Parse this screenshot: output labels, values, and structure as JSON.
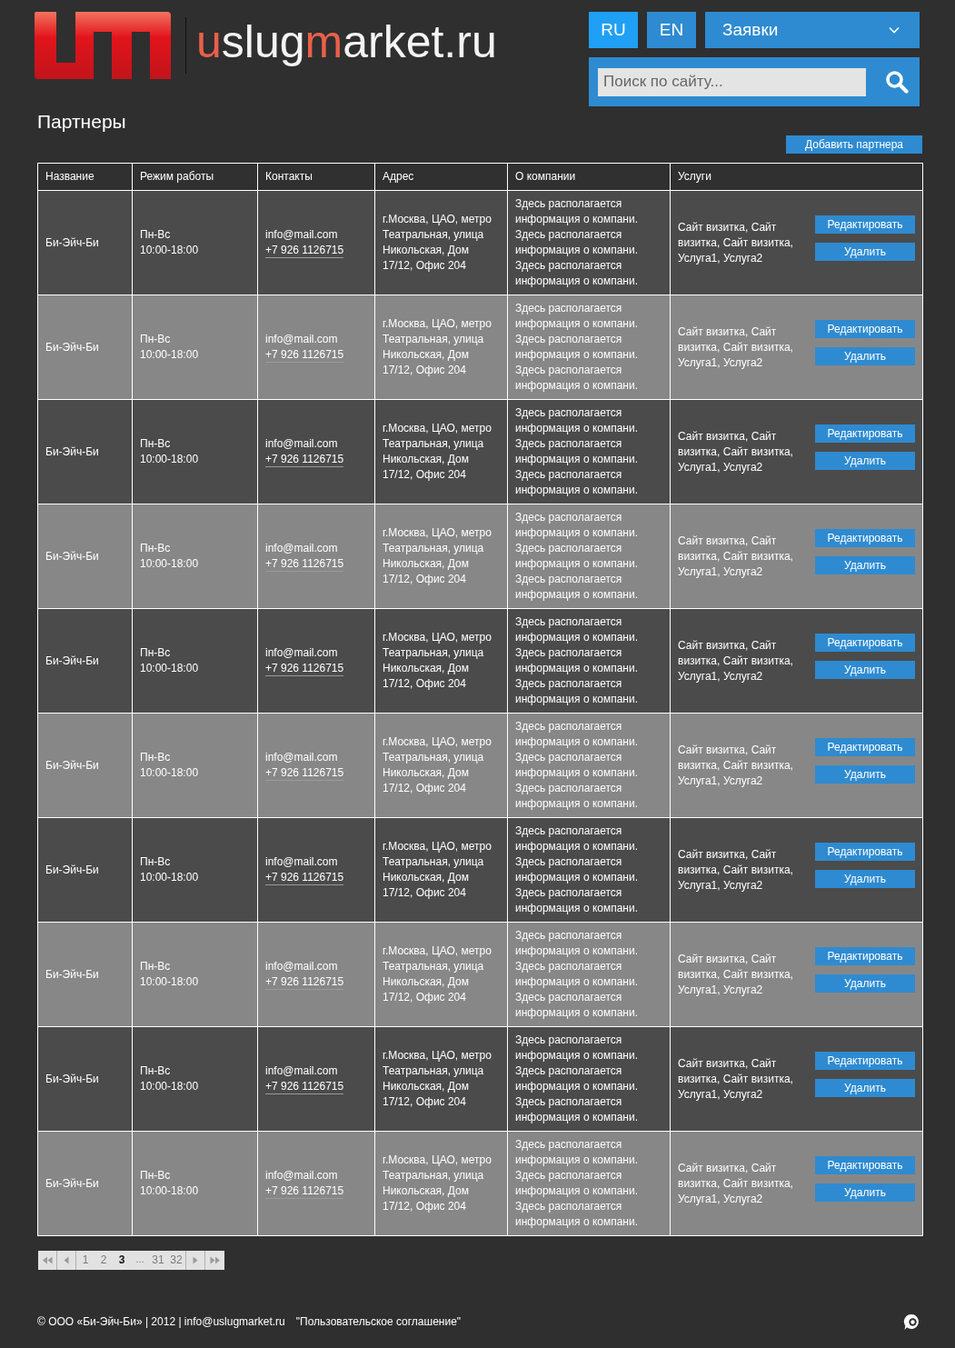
{
  "header": {
    "logo": {
      "parts": [
        {
          "text": "u",
          "accent": true
        },
        {
          "text": "slug",
          "accent": false
        },
        {
          "text": "m",
          "accent": true
        },
        {
          "text": "arket.ru",
          "accent": false
        }
      ]
    },
    "languages": [
      {
        "label": "RU",
        "selected": true
      },
      {
        "label": "EN",
        "selected": false
      }
    ],
    "menu": {
      "label": "Заявки"
    },
    "search": {
      "placeholder": "Поиск по сайту..."
    }
  },
  "page": {
    "title": "Партнеры",
    "add_button": "Добавить партнера"
  },
  "table": {
    "columns": [
      "Название",
      "Режим работы",
      "Контакты",
      "Адрес",
      "О компании",
      "Услуги"
    ],
    "rows": [
      {
        "name": "Би-Эйч-Би",
        "days": "Пн-Вс",
        "time": "10:00-18:00",
        "email": "info@mail.com",
        "phone": "+7 926 1126715",
        "address": "г.Москва, ЦАО, метро Театральная, улица Никольская, Дом 17/12, Офис 204",
        "about": "Здесь располагается информация о компани. Здесь располагается информация о компани. Здесь располагается информация о компани.",
        "services": "Сайт визитка, Сайт визитка, Сайт визитка, Услуга1, Услуга2",
        "actions": [
          "Редактировать",
          "Удалить"
        ]
      },
      {
        "name": "Би-Эйч-Би",
        "days": "Пн-Вс",
        "time": "10:00-18:00",
        "email": "info@mail.com",
        "phone": "+7 926 1126715",
        "address": "г.Москва, ЦАО, метро Театральная, улица Никольская, Дом 17/12, Офис 204",
        "about": "Здесь располагается информация о компани. Здесь располагается информация о компани. Здесь располагается информация о компани.",
        "services": "Сайт визитка, Сайт визитка, Сайт визитка, Услуга1, Услуга2",
        "actions": [
          "Редактировать",
          "Удалить"
        ]
      },
      {
        "name": "Би-Эйч-Би",
        "days": "Пн-Вс",
        "time": "10:00-18:00",
        "email": "info@mail.com",
        "phone": "+7 926 1126715",
        "address": "г.Москва, ЦАО, метро Театральная, улица Никольская, Дом 17/12, Офис 204",
        "about": "Здесь располагается информация о компани. Здесь располагается информация о компани. Здесь располагается информация о компани.",
        "services": "Сайт визитка, Сайт визитка, Сайт визитка, Услуга1, Услуга2",
        "actions": [
          "Редактировать",
          "Удалить"
        ]
      },
      {
        "name": "Би-Эйч-Би",
        "days": "Пн-Вс",
        "time": "10:00-18:00",
        "email": "info@mail.com",
        "phone": "+7 926 1126715",
        "address": "г.Москва, ЦАО, метро Театральная, улица Никольская, Дом 17/12, Офис 204",
        "about": "Здесь располагается информация о компани. Здесь располагается информация о компани. Здесь располагается информация о компани.",
        "services": "Сайт визитка, Сайт визитка, Сайт визитка, Услуга1, Услуга2",
        "actions": [
          "Редактировать",
          "Удалить"
        ]
      },
      {
        "name": "Би-Эйч-Би",
        "days": "Пн-Вс",
        "time": "10:00-18:00",
        "email": "info@mail.com",
        "phone": "+7 926 1126715",
        "address": "г.Москва, ЦАО, метро Театральная, улица Никольская, Дом 17/12, Офис 204",
        "about": "Здесь располагается информация о компани. Здесь располагается информация о компани. Здесь располагается информация о компани.",
        "services": "Сайт визитка, Сайт визитка, Сайт визитка, Услуга1, Услуга2",
        "actions": [
          "Редактировать",
          "Удалить"
        ]
      },
      {
        "name": "Би-Эйч-Би",
        "days": "Пн-Вс",
        "time": "10:00-18:00",
        "email": "info@mail.com",
        "phone": "+7 926 1126715",
        "address": "г.Москва, ЦАО, метро Театральная, улица Никольская, Дом 17/12, Офис 204",
        "about": "Здесь располагается информация о компани. Здесь располагается информация о компани. Здесь располагается информация о компани.",
        "services": "Сайт визитка, Сайт визитка, Сайт визитка, Услуга1, Услуга2",
        "actions": [
          "Редактировать",
          "Удалить"
        ]
      },
      {
        "name": "Би-Эйч-Би",
        "days": "Пн-Вс",
        "time": "10:00-18:00",
        "email": "info@mail.com",
        "phone": "+7 926 1126715",
        "address": "г.Москва, ЦАО, метро Театральная, улица Никольская, Дом 17/12, Офис 204",
        "about": "Здесь располагается информация о компани. Здесь располагается информация о компани. Здесь располагается информация о компани.",
        "services": "Сайт визитка, Сайт визитка, Сайт визитка, Услуга1, Услуга2",
        "actions": [
          "Редактировать",
          "Удалить"
        ]
      },
      {
        "name": "Би-Эйч-Би",
        "days": "Пн-Вс",
        "time": "10:00-18:00",
        "email": "info@mail.com",
        "phone": "+7 926 1126715",
        "address": "г.Москва, ЦАО, метро Театральная, улица Никольская, Дом 17/12, Офис 204",
        "about": "Здесь располагается информация о компани. Здесь располагается информация о компани. Здесь располагается информация о компани.",
        "services": "Сайт визитка, Сайт визитка, Сайт визитка, Услуга1, Услуга2",
        "actions": [
          "Редактировать",
          "Удалить"
        ]
      },
      {
        "name": "Би-Эйч-Би",
        "days": "Пн-Вс",
        "time": "10:00-18:00",
        "email": "info@mail.com",
        "phone": "+7 926 1126715",
        "address": "г.Москва, ЦАО, метро Театральная, улица Никольская, Дом 17/12, Офис 204",
        "about": "Здесь располагается информация о компани. Здесь располагается информация о компани. Здесь располагается информация о компани.",
        "services": "Сайт визитка, Сайт визитка, Сайт визитка, Услуга1, Услуга2",
        "actions": [
          "Редактировать",
          "Удалить"
        ]
      },
      {
        "name": "Би-Эйч-Би",
        "days": "Пн-Вс",
        "time": "10:00-18:00",
        "email": "info@mail.com",
        "phone": "+7 926 1126715",
        "address": "г.Москва, ЦАО, метро Театральная, улица Никольская, Дом 17/12, Офис 204",
        "about": "Здесь располагается информация о компани. Здесь располагается информация о компани. Здесь располагается информация о компани.",
        "services": "Сайт визитка, Сайт визитка, Сайт визитка, Услуга1, Услуга2",
        "actions": [
          "Редактировать",
          "Удалить"
        ]
      }
    ]
  },
  "pagination": {
    "items": [
      {
        "kind": "first"
      },
      {
        "kind": "prev"
      },
      {
        "kind": "page",
        "label": "1",
        "selected": false
      },
      {
        "kind": "page",
        "label": "2",
        "selected": false
      },
      {
        "kind": "page",
        "label": "3",
        "selected": true
      },
      {
        "kind": "gap",
        "label": "..."
      },
      {
        "kind": "page",
        "label": "31",
        "selected": false
      },
      {
        "kind": "page",
        "label": "32",
        "selected": false
      },
      {
        "kind": "next"
      },
      {
        "kind": "last"
      }
    ]
  },
  "footer": {
    "copyright": "© ООО «Би-Эйч-Би» | 2012 | info@uslugmarket.ru",
    "agreement": "\"Пользовательское соглашение\""
  }
}
